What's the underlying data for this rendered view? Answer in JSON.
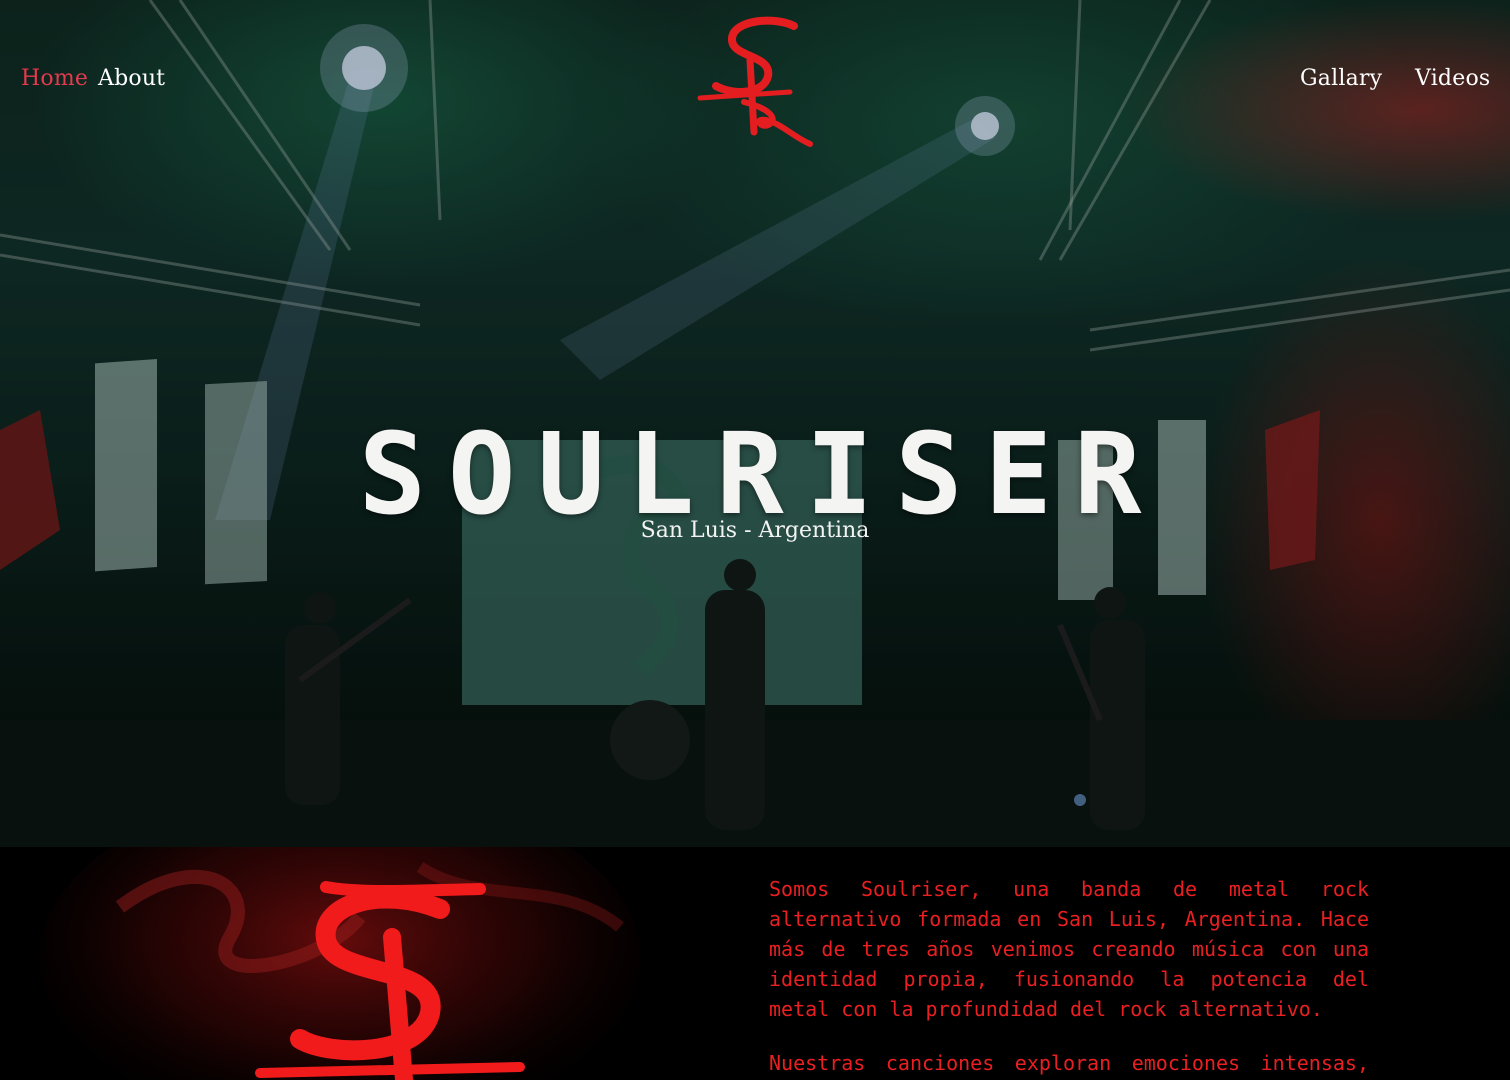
{
  "nav": {
    "home": "Home",
    "about": "About",
    "gallary": "Gallary",
    "videos": "Videos"
  },
  "hero": {
    "title": "SOULRISER",
    "subtitle": "San Luis - Argentina"
  },
  "about": {
    "paragraph_1": "Somos Soulriser, una banda de metal rock alternativo formada en San Luis, Argentina. Hace más de tres años venimos creando música con una identidad propia, fusionando la potencia del metal con la profundidad del rock alternativo.",
    "paragraph_2": "Nuestras canciones exploran emociones intensas, la"
  },
  "colors": {
    "accent_red": "#ea1f22",
    "nav_active": "#e23a4e",
    "text_light": "#f4f4f2",
    "background_dark": "#000000"
  },
  "icons": {
    "brand_logo": "sr-monogram-logo"
  }
}
